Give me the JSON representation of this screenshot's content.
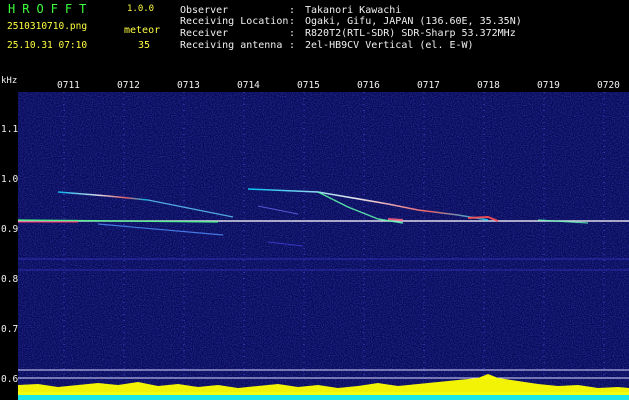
{
  "header": {
    "app_title": "HROFFT",
    "version": "1.0.0",
    "file_name": "2510310710.png",
    "meteor_label": "meteor",
    "datetime": "25.10.31 07:10",
    "meteor_count": "35",
    "info": [
      {
        "key": "Observer",
        "value": "Takanori Kawachi"
      },
      {
        "key": "Receiving Location",
        "value": "Ogaki, Gifu, JAPAN (136.60E, 35.35N)"
      },
      {
        "key": "Receiver",
        "value": "R820T2(RTL-SDR) SDR-Sharp 53.372MHz"
      },
      {
        "key": "Receiving antenna",
        "value": "2el-HB9CV Vertical (el. E-W)"
      }
    ],
    "separator": ":"
  },
  "axis": {
    "unit": "kHz",
    "x_ticks": [
      "0711",
      "0712",
      "0713",
      "0714",
      "0715",
      "0716",
      "0717",
      "0718",
      "0719",
      "0720"
    ],
    "y_ticks": [
      "1.1",
      "1.0",
      "0.9",
      "0.8",
      "0.7",
      "0.6"
    ]
  },
  "colors": {
    "header_green": "#3cff3c",
    "header_white": "#f0f0f0",
    "header_yellow": "#ffff40",
    "background": "#0a0a5a",
    "carrier": "#ffffff",
    "bottom_band_yellow": "#ffff00",
    "bottom_band_cyan": "#00e5ff"
  }
}
